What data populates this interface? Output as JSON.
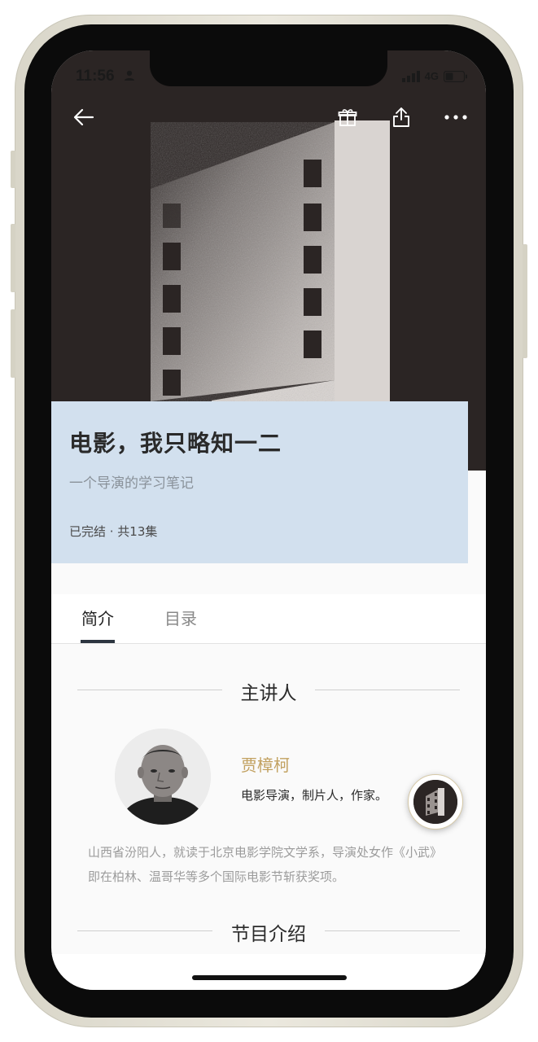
{
  "status_bar": {
    "time": "11:56",
    "network": "4G"
  },
  "navigation": {
    "back_icon": "arrow-left-icon",
    "gift_icon": "gift-icon",
    "share_icon": "share-icon",
    "more_icon": "more-dots-icon"
  },
  "course": {
    "title": "电影，我只略知一二",
    "subtitle": "一个导演的学习笔记",
    "meta": "已完结 · 共13集"
  },
  "tabs": [
    {
      "label": "简介",
      "active": true
    },
    {
      "label": "目录",
      "active": false
    }
  ],
  "sections": {
    "lecturer_heading": "主讲人",
    "program_heading": "节目介绍"
  },
  "lecturer": {
    "name": "贾樟柯",
    "role": "电影导演，制片人，作家。",
    "bio": "山西省汾阳人，就读于北京电影学院文学系，导演处女作《小武》即在柏林、温哥华等多个国际电影节斩获奖项。"
  },
  "colors": {
    "hero_background": "#2b2524",
    "title_card": "#d2e0ee",
    "lecturer_name": "#c2a160",
    "tab_underline": "#2c3540"
  }
}
